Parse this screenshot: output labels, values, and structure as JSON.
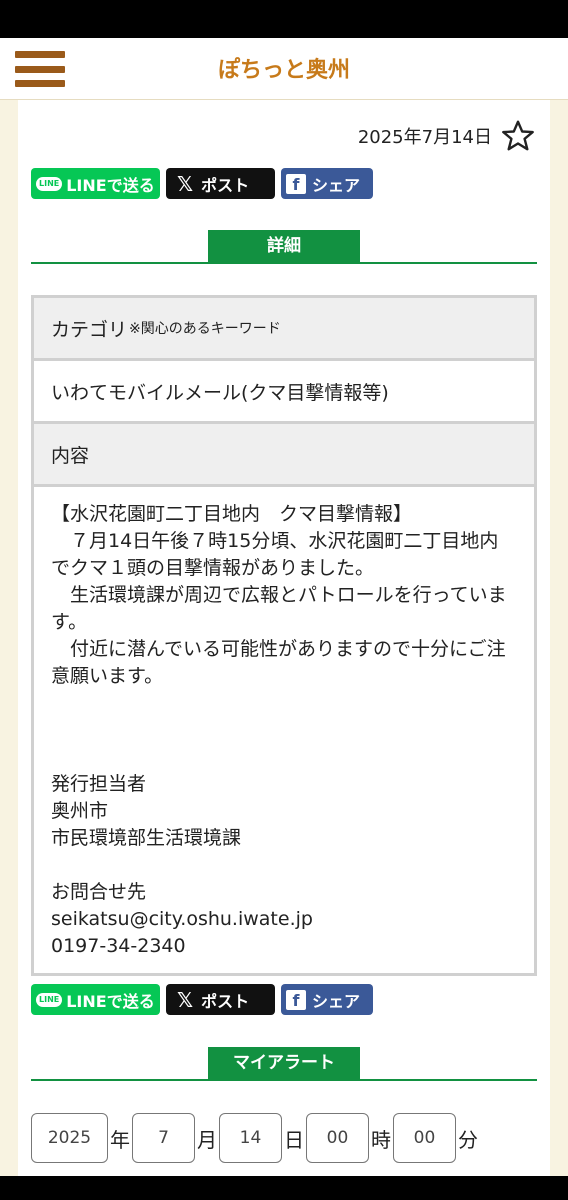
{
  "header": {
    "title": "ぽちっと奥州"
  },
  "post": {
    "date": "2025年7月14日"
  },
  "share": {
    "line": "LINEで送る",
    "line_logo": "LINE",
    "x": "ポスト",
    "facebook": "シェア"
  },
  "details": {
    "section_label": "詳細",
    "category_label": "カテゴリ",
    "keyword_note": "※関心のあるキーワード",
    "category_value": "いわてモバイルメール(クマ目撃情報等)",
    "content_label": "内容",
    "content_text": "【水沢花園町二丁目地内　クマ目撃情報】\n　７月14日午後７時15分頃、水沢花園町二丁目地内でクマ１頭の目撃情報がありました。\n　生活環境課が周辺で広報とパトロールを行っています。\n　付近に潜んでいる可能性がありますので十分にご注意願います。\n\n\n\n発行担当者\n奥州市\n市民環境部生活環境課\n\nお問合せ先\nseikatsu@city.oshu.iwate.jp\n0197-34-2340"
  },
  "my_alert": {
    "section_label": "マイアラート",
    "year": "2025",
    "year_unit": "年",
    "month": "7",
    "month_unit": "月",
    "day": "14",
    "day_unit": "日",
    "hour": "00",
    "hour_unit": "時",
    "minute": "00",
    "minute_unit": "分"
  },
  "colors": {
    "accent_green": "#129141",
    "brand_brown": "#9a5a1a",
    "title_orange": "#c77a1a",
    "line_green": "#06c755",
    "facebook_blue": "#3b5998"
  }
}
